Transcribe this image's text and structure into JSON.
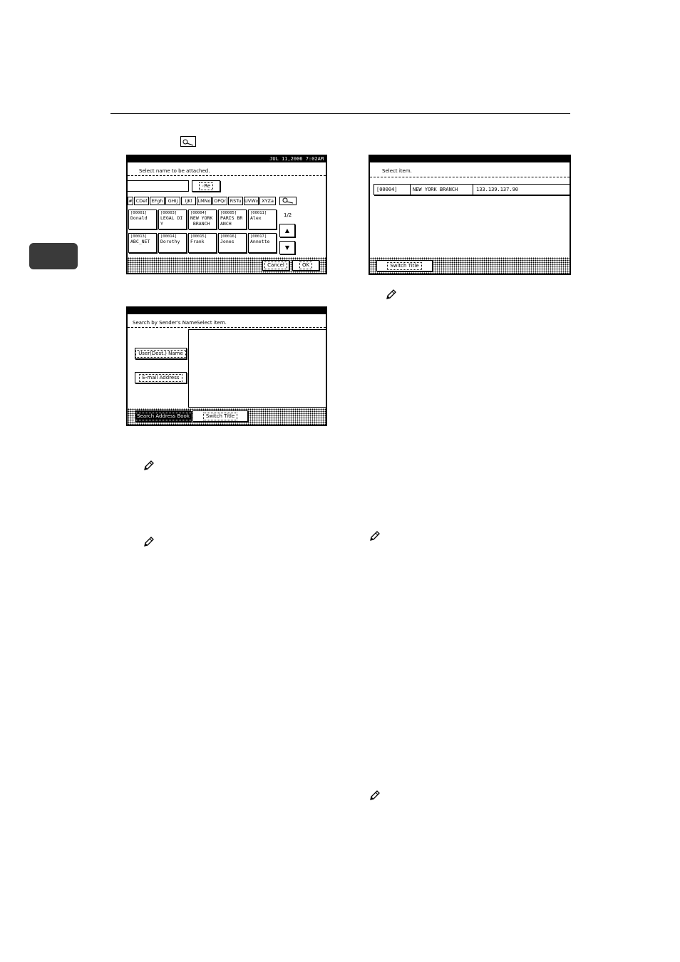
{
  "screen1": {
    "status": "JUL  11,2006  7:02AM",
    "prompt": "Select name to be attached.",
    "search_button": "Re",
    "tabs": [
      "#",
      "CDef",
      "EFgh",
      "GHIj",
      "IJKl",
      "LMNo",
      "OPQr",
      "RSTu",
      "UVWx",
      "XYZa"
    ],
    "entries": [
      {
        "code": "[00001]",
        "name": [
          "Donald"
        ]
      },
      {
        "code": "[00003]",
        "name": [
          "LEGAL DI",
          "Y"
        ]
      },
      {
        "code": "[00004]",
        "name": [
          "NEW YORK",
          " BRANCH"
        ]
      },
      {
        "code": "[00005]",
        "name": [
          "PARIS BR",
          "ANCH"
        ]
      },
      {
        "code": "[00011]",
        "name": [
          "Alex"
        ]
      },
      {
        "code": "[00013]",
        "name": [
          "ABC_NET"
        ]
      },
      {
        "code": "[00014]",
        "name": [
          "Dorothy"
        ]
      },
      {
        "code": "[00015]",
        "name": [
          "Frank"
        ]
      },
      {
        "code": "[00016]",
        "name": [
          "Jones"
        ]
      },
      {
        "code": "[00017]",
        "name": [
          "Annette"
        ]
      }
    ],
    "page": "1/2",
    "cancel": "Cancel",
    "ok": "OK"
  },
  "screen2": {
    "header_left": "Search by Sender's Name",
    "header_right": "Select item.",
    "btn_user": "User(Dest.) Name",
    "btn_email": "E-mail Address",
    "btn_search_ab": "Search Address Book",
    "btn_switch": "Switch Title"
  },
  "screen3": {
    "header": "Select item.",
    "row": {
      "code": "[00004]",
      "name": "NEW YORK BRANCH",
      "address": "133.139.137.90"
    },
    "btn_switch": "Switch Title"
  }
}
